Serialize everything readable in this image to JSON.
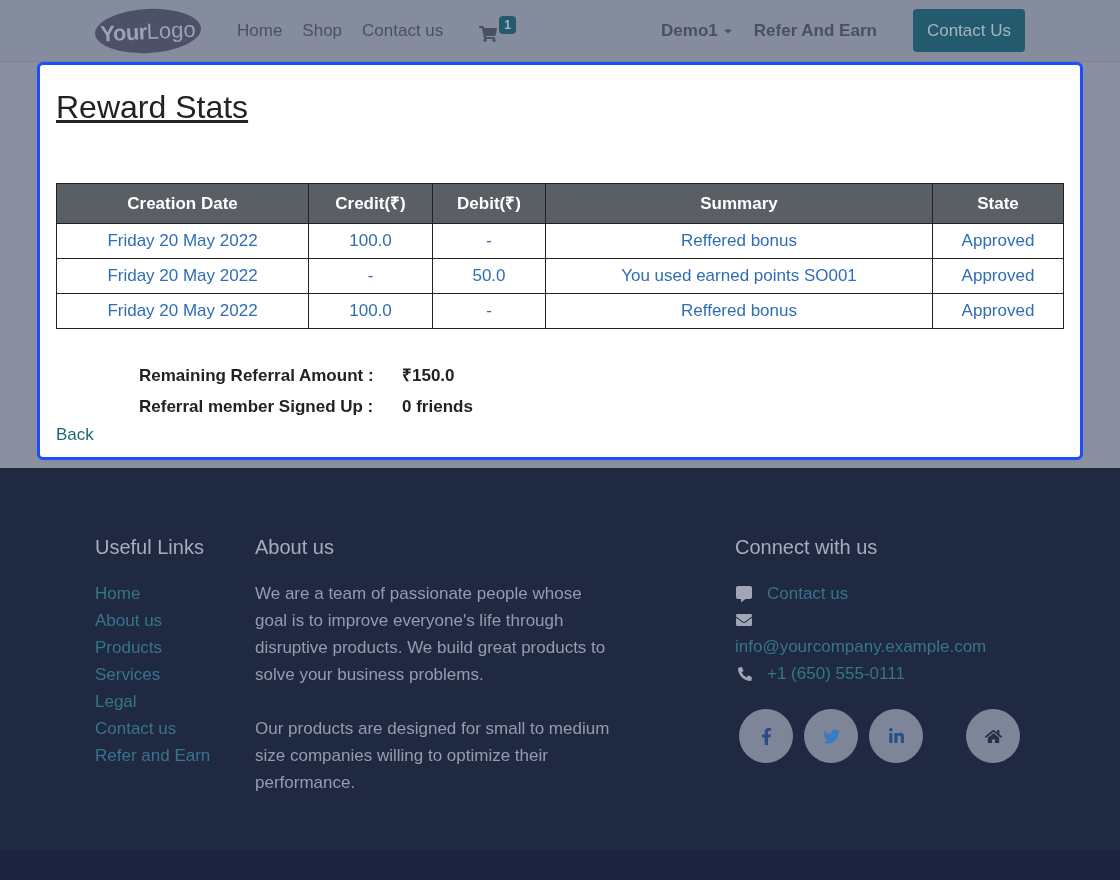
{
  "header": {
    "logo": {
      "bold": "Your",
      "light": "Logo"
    },
    "nav": [
      {
        "label": "Home"
      },
      {
        "label": "Shop"
      },
      {
        "label": "Contact us"
      }
    ],
    "cart_count": "1",
    "user": "Demo1",
    "refer": "Refer And Earn",
    "cta": "Contact Us"
  },
  "dialog": {
    "title": "Reward Stats",
    "table": {
      "columns": [
        "Creation Date",
        "Credit(₹)",
        "Debit(₹)",
        "Summary",
        "State"
      ],
      "rows": [
        [
          "Friday 20 May 2022",
          "100.0",
          "-",
          "Reffered bonus",
          "Approved"
        ],
        [
          "Friday 20 May 2022",
          "-",
          "50.0",
          "You used earned points SO001",
          "Approved"
        ],
        [
          "Friday 20 May 2022",
          "100.0",
          "-",
          "Reffered bonus",
          "Approved"
        ]
      ]
    },
    "summary": [
      {
        "label": "Remaining Referral Amount :",
        "value": "₹150.0"
      },
      {
        "label": "Referral member Signed Up :",
        "value": "0 friends"
      }
    ],
    "back": "Back"
  },
  "footer": {
    "useful_links": {
      "title": "Useful Links",
      "items": [
        "Home",
        "About us",
        "Products",
        "Services",
        "Legal",
        "Contact us",
        "Refer and Earn"
      ]
    },
    "about": {
      "title": "About us",
      "paragraphs": [
        "We are a team of passionate people whose goal is to improve everyone's life through disruptive products. We build great products to solve your business problems.",
        "Our products are designed for small to medium size companies willing to optimize their performance."
      ]
    },
    "connect": {
      "title": "Connect with us",
      "contact": "Contact us",
      "email": "info@yourcompany.example.com",
      "phone": "+1 (650) 555-0111",
      "social": [
        {
          "kind": "facebook"
        },
        {
          "kind": "twitter"
        },
        {
          "kind": "linkedin"
        },
        {
          "kind": "home"
        }
      ]
    }
  }
}
